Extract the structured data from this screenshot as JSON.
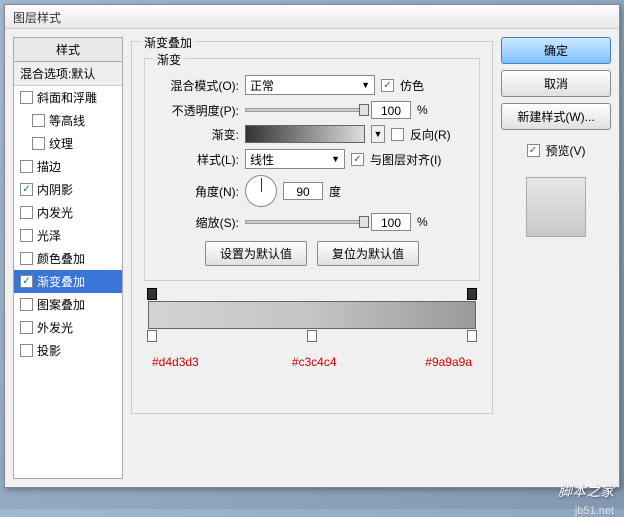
{
  "title": "图层样式",
  "left": {
    "header": "样式",
    "sub": "混合选项:默认",
    "items": [
      {
        "label": "斜面和浮雕",
        "checked": false,
        "indent": false
      },
      {
        "label": "等高线",
        "checked": false,
        "indent": true
      },
      {
        "label": "纹理",
        "checked": false,
        "indent": true
      },
      {
        "label": "描边",
        "checked": false,
        "indent": false
      },
      {
        "label": "内阴影",
        "checked": true,
        "indent": false
      },
      {
        "label": "内发光",
        "checked": false,
        "indent": false
      },
      {
        "label": "光泽",
        "checked": false,
        "indent": false
      },
      {
        "label": "颜色叠加",
        "checked": false,
        "indent": false
      },
      {
        "label": "渐变叠加",
        "checked": true,
        "indent": false,
        "selected": true
      },
      {
        "label": "图案叠加",
        "checked": false,
        "indent": false
      },
      {
        "label": "外发光",
        "checked": false,
        "indent": false
      },
      {
        "label": "投影",
        "checked": false,
        "indent": false
      }
    ]
  },
  "center": {
    "group_title": "渐变叠加",
    "inner_title": "渐变",
    "blend_label": "混合模式(O):",
    "blend_value": "正常",
    "dither_label": "仿色",
    "dither_checked": true,
    "opacity_label": "不透明度(P):",
    "opacity_value": "100",
    "pct": "%",
    "gradient_label": "渐变:",
    "reverse_label": "反向(R)",
    "reverse_checked": false,
    "style_label": "样式(L):",
    "style_value": "线性",
    "align_label": "与图层对齐(I)",
    "align_checked": true,
    "angle_label": "角度(N):",
    "angle_value": "90",
    "angle_unit": "度",
    "scale_label": "缩放(S):",
    "scale_value": "100",
    "btn_default": "设置为默认值",
    "btn_reset": "复位为默认值",
    "stops": [
      "#d4d3d3",
      "#c3c4c4",
      "#9a9a9a"
    ]
  },
  "right": {
    "ok": "确定",
    "cancel": "取消",
    "new_style": "新建样式(W)...",
    "preview_label": "预览(V)",
    "preview_checked": true
  },
  "watermark": "脚本之家",
  "watermark_url": "jb51.net"
}
